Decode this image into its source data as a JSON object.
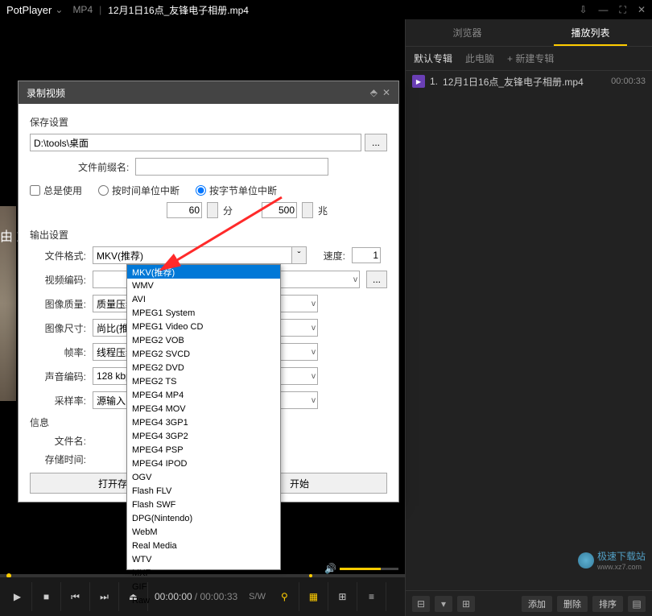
{
  "titlebar": {
    "app": "PotPlayer",
    "format": "MP4",
    "file": "12月1日16点_友锋电子相册.mp4"
  },
  "sidepanel": {
    "tabs": [
      "浏览器",
      "播放列表"
    ],
    "activeTab": 1,
    "subtabs": {
      "a": "默认专辑",
      "b": "此电脑",
      "add": "+ 新建专辑"
    },
    "item": {
      "num": "1.",
      "name": "12月1日16点_友锋电子相册.mp4",
      "dur": "00:00:33"
    },
    "bottom": {
      "add": "添加",
      "del": "删除",
      "sort": "排序"
    }
  },
  "vidtext": "由 友",
  "controls": {
    "t1": "00:00:00",
    "t2": "00:00:33",
    "sw": "S/W"
  },
  "dialog": {
    "title": "录制视频",
    "save": "保存设置",
    "path": "D:\\tools\\桌面",
    "prefix_lbl": "文件前缀名:",
    "always": "总是使用",
    "break_time": "按时间单位中断",
    "break_byte": "按字节单位中断",
    "num1": "60",
    "unit1": "分",
    "num2": "500",
    "unit2": "兆",
    "output": "输出设置",
    "fmt_lbl": "文件格式:",
    "fmt_val": "MKV(推荐)",
    "speed_lbl": "速度:",
    "speed_val": "1",
    "venc_lbl": "视频编码:",
    "qual_lbl": "图像质量:",
    "qual_val": "质量压缩",
    "size_lbl": "图像尺寸:",
    "size_val": "尚比(推荐)",
    "fps_lbl": "帧率:",
    "fps_val": "线程压缩视频",
    "aenc_lbl": "声音编码:",
    "aenc_val": "128 kbps",
    "rate_lbl": "采样率:",
    "rate_val": "源输入",
    "info": "信息",
    "fname_lbl": "文件名:",
    "stime_lbl": "存储时间:",
    "btn1": "打开存档",
    "btn2": "开始"
  },
  "formats": [
    "MKV(推荐)",
    "WMV",
    "AVI",
    "MPEG1 System",
    "MPEG1 Video CD",
    "MPEG2 VOB",
    "MPEG2 SVCD",
    "MPEG2 DVD",
    "MPEG2 TS",
    "MPEG4 MP4",
    "MPEG4 MOV",
    "MPEG4 3GP1",
    "MPEG4 3GP2",
    "MPEG4 PSP",
    "MPEG4 IPOD",
    "OGV",
    "Flash FLV",
    "Flash SWF",
    "DPG(Nintendo)",
    "WebM",
    "Real Media",
    "WTV",
    "MXF",
    "GIF",
    "Raw"
  ],
  "watermark": {
    "name": "极速下载站",
    "url": "www.xz7.com"
  }
}
